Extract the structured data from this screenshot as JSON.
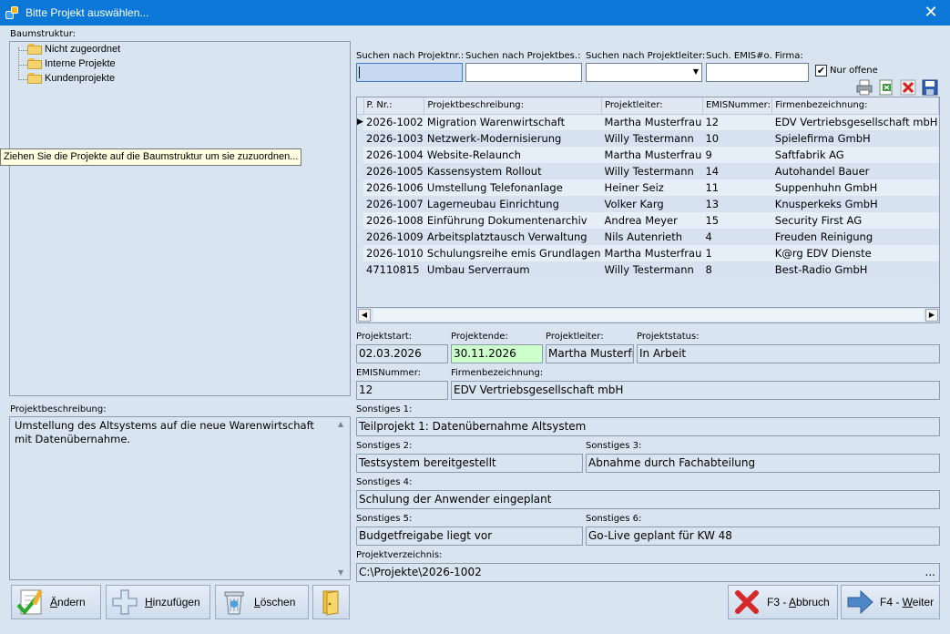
{
  "window": {
    "title": "Bitte Projekt auswählen..."
  },
  "tree": {
    "label": "Baumstruktur:",
    "items": [
      "Nicht zugeordnet",
      "Interne Projekte",
      "Kundenprojekte"
    ]
  },
  "tooltip": "Ziehen Sie die Projekte auf die Baumstruktur um sie zuzuordnen...",
  "search": {
    "nr_label": "Suchen nach Projektnr.:",
    "desc_label": "Suchen nach Projektbes.:",
    "leader_label": "Suchen nach Projektleiter:",
    "emis_label": "Such. EMIS#o. Firma:",
    "only_open_label": "Nur offene",
    "only_open_checked": true
  },
  "grid": {
    "columns": [
      "P. Nr.:",
      "Projektbeschreibung:",
      "Projektleiter:",
      "EMISNummer:",
      "Firmenbezeichnung:"
    ],
    "rows": [
      [
        "2026-1002",
        "Migration Warenwirtschaft",
        "Martha Musterfrau",
        "12",
        "EDV Vertriebsgesellschaft mbH"
      ],
      [
        "2026-1003",
        "Netzwerk-Modernisierung",
        "Willy Testermann",
        "10",
        "Spielefirma GmbH"
      ],
      [
        "2026-1004",
        "Website-Relaunch",
        "Martha Musterfrau",
        "9",
        "Saftfabrik AG"
      ],
      [
        "2026-1005",
        "Kassensystem Rollout",
        "Willy Testermann",
        "14",
        "Autohandel Bauer"
      ],
      [
        "2026-1006",
        "Umstellung Telefonanlage",
        "Heiner Seiz",
        "11",
        "Suppenhuhn GmbH"
      ],
      [
        "2026-1007",
        "Lagerneubau Einrichtung",
        "Volker Karg",
        "13",
        "Knusperkeks GmbH"
      ],
      [
        "2026-1008",
        "Einführung Dokumentenarchiv",
        "Andrea Meyer",
        "15",
        "Security First AG"
      ],
      [
        "2026-1009",
        "Arbeitsplatztausch Verwaltung",
        "Nils Autenrieth",
        "4",
        "Freuden Reinigung"
      ],
      [
        "2026-1010",
        "Schulungsreihe emis Grundlagen",
        "Martha Musterfrau",
        "1",
        "K@rg EDV Dienste"
      ],
      [
        "47110815",
        "Umbau Serverraum",
        "Willy Testermann",
        "8",
        "Best-Radio GmbH"
      ]
    ]
  },
  "details": {
    "start_label": "Projektstart:",
    "start": "02.03.2026",
    "end_label": "Projektende:",
    "end": "30.11.2026",
    "leader_label": "Projektleiter:",
    "leader": "Martha Musterfrau",
    "status_label": "Projektstatus:",
    "status": "In Arbeit",
    "emis_label": "EMISNummer:",
    "emis": "12",
    "company_label": "Firmenbezeichnung:",
    "company": "EDV Vertriebsgesellschaft mbH",
    "s1_label": "Sonstiges 1:",
    "s1": "Teilprojekt 1: Datenübernahme Altsystem",
    "s2_label": "Sonstiges 2:",
    "s2": "Testsystem bereitgestellt",
    "s3_label": "Sonstiges 3:",
    "s3": "Abnahme durch Fachabteilung",
    "s4_label": "Sonstiges 4:",
    "s4": "Schulung der Anwender eingeplant",
    "s5_label": "Sonstiges 5:",
    "s5": "Budgetfreigabe liegt vor",
    "s6_label": "Sonstiges 6:",
    "s6": "Go-Live geplant für KW 48",
    "dir_label": "Projektverzeichnis:",
    "dir": "C:\\Projekte\\2026-1002",
    "dir_btn": "..."
  },
  "description": {
    "label": "Projektbeschreibung:",
    "text": "Umstellung des Altsystems auf die neue Warenwirtschaft mit Datenübernahme."
  },
  "buttons": {
    "change_rest": "ndern",
    "change_key": "Ä",
    "add_key": "H",
    "add_rest": "inzufügen",
    "delete_key": "L",
    "delete_rest": "öschen",
    "cancel_pre": "F3 - ",
    "cancel_key": "A",
    "cancel_rest": "bbruch",
    "next_pre": "F4 - ",
    "next_key": "W",
    "next_rest": "eiter"
  },
  "colors": {
    "titlebar": "#0b78d8",
    "end_date_bg": "#ccffcc",
    "search_active": "#c6d9f0"
  }
}
